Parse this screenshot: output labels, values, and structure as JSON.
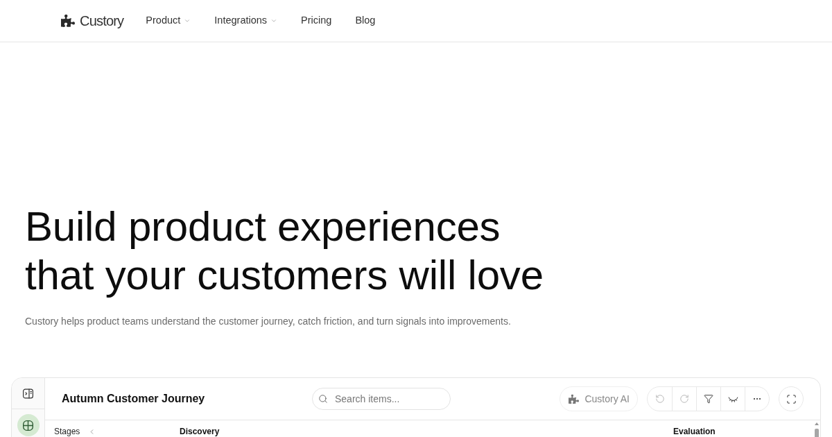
{
  "nav": {
    "logo": "Custory",
    "items": [
      {
        "label": "Product",
        "has_menu": true
      },
      {
        "label": "Integrations",
        "has_menu": true
      },
      {
        "label": "Pricing",
        "has_menu": false
      },
      {
        "label": "Blog",
        "has_menu": false
      }
    ]
  },
  "hero": {
    "title_lines": [
      "Build product experiences",
      "that your customers will love"
    ],
    "subtitle": "Custory helps product teams understand the customer journey, catch friction, and turn signals into improvements."
  },
  "app": {
    "rail": [
      {
        "kind": "panel",
        "selected": false
      },
      {
        "kind": "grid",
        "selected": true
      }
    ],
    "title": "Autumn Customer Journey",
    "search": {
      "placeholder": "Search items..."
    },
    "ai_button": "Custory AI",
    "toolbar": [
      {
        "kind": "undo",
        "disabled": true
      },
      {
        "kind": "redo",
        "disabled": true
      },
      {
        "kind": "filter",
        "disabled": false
      },
      {
        "kind": "hide",
        "disabled": false
      },
      {
        "kind": "more",
        "disabled": false
      }
    ],
    "board": {
      "stages_label": "Stages",
      "columns": [
        "Discovery",
        "Evaluation"
      ]
    }
  }
}
